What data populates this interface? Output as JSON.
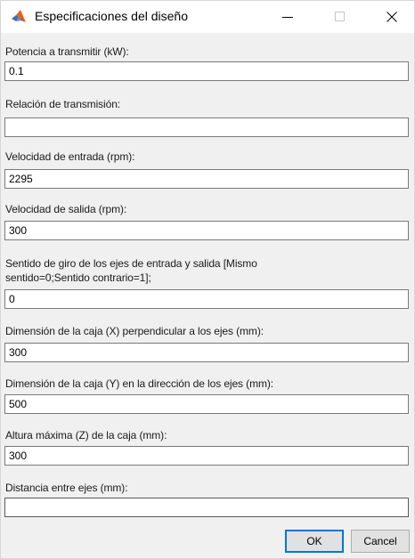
{
  "window": {
    "title": "Especificaciones del diseño",
    "icon": "matlab-logo-icon",
    "controls": {
      "minimize": "—",
      "maximize": "☐",
      "close": "✕"
    }
  },
  "fields": [
    {
      "label": "Potencia a transmitir (kW):",
      "value": "0.1"
    },
    {
      "label": "Relación de transmisión:",
      "value": ""
    },
    {
      "label": "Velocidad de entrada (rpm):",
      "value": "2295"
    },
    {
      "label": "Velocidad de salida (rpm):",
      "value": "300"
    },
    {
      "label": "Sentido de giro de los ejes de entrada y salida [Mismo sentido=0;Sentido contrario=1];",
      "value": "0"
    },
    {
      "label": "Dimensión de la caja (X) perpendicular a los ejes (mm):",
      "value": "300"
    },
    {
      "label": "Dimensión de la caja (Y) en la dirección de los ejes  (mm):",
      "value": "500"
    },
    {
      "label": "Altura máxima (Z) de la caja (mm):",
      "value": "300"
    },
    {
      "label": "Distancia entre ejes (mm):",
      "value": ""
    }
  ],
  "buttons": {
    "ok": "OK",
    "cancel": "Cancel"
  },
  "colors": {
    "window_bg": "#f0f0f0",
    "titlebar_bg": "#ffffff",
    "focus_accent": "#0078d7",
    "input_border": "#7a7a7a"
  }
}
